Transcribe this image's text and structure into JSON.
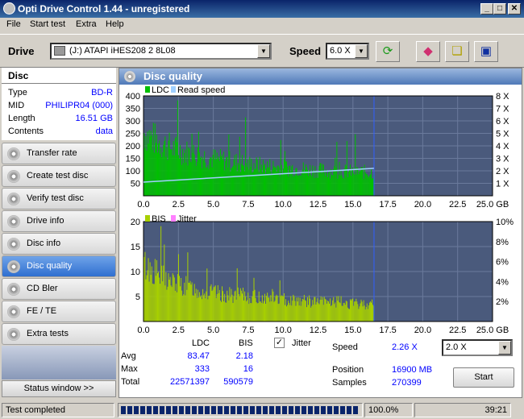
{
  "window": {
    "title": "Opti Drive Control 1.44 - unregistered",
    "min": "_",
    "max": "□",
    "close": "✕"
  },
  "menu": [
    "File",
    "Start test",
    "Extra",
    "Help"
  ],
  "toolbar": {
    "drive_label": "Drive",
    "drive_value": "(J:)  ATAPI iHES208   2 8L08",
    "speed_label": "Speed",
    "speed_value": "6.0 X"
  },
  "disc": {
    "header": "Disc",
    "rows": [
      {
        "k": "Type",
        "v": "BD-R"
      },
      {
        "k": "MID",
        "v": "PHILIPR04 (000)"
      },
      {
        "k": "Length",
        "v": "16.51 GB"
      },
      {
        "k": "Contents",
        "v": "data"
      }
    ]
  },
  "nav": [
    "Transfer rate",
    "Create test disc",
    "Verify test disc",
    "Drive info",
    "Disc info",
    "Disc quality",
    "CD Bler",
    "FE / TE",
    "Extra tests"
  ],
  "nav_selected": "Disc quality",
  "status_window": "Status window >>",
  "panel_title": "Disc quality",
  "chart_data": [
    {
      "type": "bar",
      "legend": [
        "LDC",
        "Read speed"
      ],
      "colors": {
        "LDC": "#00c000",
        "Read speed": "#a0d0ff"
      },
      "xlim": [
        0,
        25
      ],
      "x_ticks": [
        "0.0",
        "2.5",
        "5.0",
        "7.5",
        "10.0",
        "12.5",
        "15.0",
        "17.5",
        "20.0",
        "22.5",
        "25.0 GB"
      ],
      "ylim": [
        0,
        400
      ],
      "y_ticks": [
        "400",
        "350",
        "300",
        "250",
        "200",
        "150",
        "100",
        "50"
      ],
      "y2_ticks": [
        "8 X",
        "7 X",
        "6 X",
        "5 X",
        "4 X",
        "3 X",
        "2 X",
        "1 X"
      ],
      "data_end": 16.51,
      "ldc_profile": {
        "x": [
          0,
          1,
          2,
          3,
          4,
          5,
          6,
          7,
          8,
          9,
          10,
          11,
          12,
          13,
          14,
          15,
          16.5
        ],
        "y": [
          290,
          250,
          220,
          200,
          185,
          170,
          160,
          150,
          140,
          135,
          130,
          125,
          120,
          115,
          112,
          110,
          108
        ]
      },
      "read_speed": {
        "x": [
          0,
          16.5
        ],
        "y": [
          1.1,
          2.2
        ]
      }
    },
    {
      "type": "bar",
      "legend": [
        "BIS",
        "Jitter"
      ],
      "colors": {
        "BIS": "#a8d000",
        "Jitter": "#ff80ff"
      },
      "xlim": [
        0,
        25
      ],
      "x_ticks": [
        "0.0",
        "2.5",
        "5.0",
        "7.5",
        "10.0",
        "12.5",
        "15.0",
        "17.5",
        "20.0",
        "22.5",
        "25.0 GB"
      ],
      "ylim": [
        0,
        20
      ],
      "y_ticks": [
        "20",
        "15",
        "10",
        "5"
      ],
      "y2_ticks": [
        "10%",
        "8%",
        "6%",
        "4%",
        "2%"
      ],
      "data_end": 16.51,
      "bis_profile": {
        "x": [
          0,
          1,
          2,
          3,
          4,
          5,
          6,
          7,
          8,
          9,
          10,
          11,
          12,
          13,
          14,
          15,
          16.5
        ],
        "y": [
          13,
          11,
          9,
          8,
          7,
          6.5,
          6,
          6,
          5.5,
          5.5,
          5,
          5,
          4.5,
          4.5,
          4.5,
          4,
          4
        ]
      }
    }
  ],
  "stats": {
    "col_ldc": "LDC",
    "col_bis": "BIS",
    "jitter_label": "Jitter",
    "jitter_check": "✓",
    "avg_label": "Avg",
    "avg_ldc": "83.47",
    "avg_bis": "2.18",
    "max_label": "Max",
    "max_ldc": "333",
    "max_bis": "16",
    "total_label": "Total",
    "total_ldc": "22571397",
    "total_bis": "590579",
    "speed_label": "Speed",
    "speed_value": "2.26 X",
    "speed_select": "2.0 X",
    "position_label": "Position",
    "position_value": "16900 MB",
    "samples_label": "Samples",
    "samples_value": "270399",
    "start_button": "Start"
  },
  "statusbar": {
    "text": "Test completed",
    "progress_pct": 100,
    "progress_text": "100.0%",
    "time": "39:21"
  }
}
